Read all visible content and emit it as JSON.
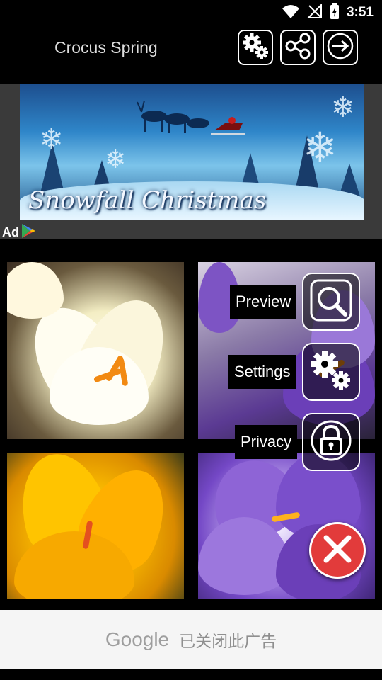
{
  "status_bar": {
    "time": "3:51",
    "icons": [
      "wifi-icon",
      "no-signal-icon",
      "battery-charging-icon"
    ]
  },
  "header": {
    "title": "Crocus Spring",
    "buttons": [
      "settings-gear-icon",
      "share-icon",
      "exit-arrow-icon"
    ]
  },
  "ad_banner": {
    "caption": "Snowfall Christmas",
    "ad_label": "Ad"
  },
  "floating_menu": {
    "items": [
      {
        "label": "Preview",
        "icon": "preview-search-icon"
      },
      {
        "label": "Settings",
        "icon": "settings-gear-icon"
      },
      {
        "label": "Privacy",
        "icon": "privacy-lock-icon"
      }
    ],
    "close_icon": "close-x-icon"
  },
  "bottom_ad": {
    "brand": "Google",
    "close_text": "已关闭此广告"
  },
  "colors": {
    "background": "#000000",
    "close_fab": "#e23b3b",
    "bottom_bar": "#f5f5f5"
  }
}
